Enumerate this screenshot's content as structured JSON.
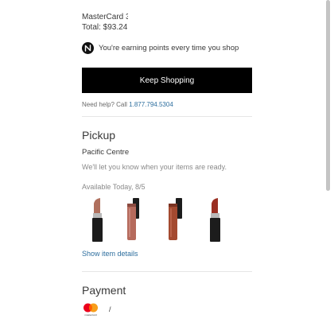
{
  "payment_summary": {
    "card_label": "MasterCard 3",
    "total_label": "Total: $93.24"
  },
  "rewards": {
    "icon": "nordstrom-n-icon",
    "message": "You're earning points every time you shop"
  },
  "keep_shopping_label": "Keep Shopping",
  "help": {
    "prefix": "Need help? Call ",
    "phone": "1.877.794.5304"
  },
  "pickup": {
    "title": "Pickup",
    "store": "Pacific Centre",
    "notify": "We'll let you know when your items are ready.",
    "availability": "Available Today, 8/5",
    "items": [
      {
        "name": "lipstick-nude",
        "icon": "lipstick-bullet-icon",
        "color": "#b0705e"
      },
      {
        "name": "liquid-lipstick-rose",
        "icon": "liquid-lipstick-icon",
        "color": "#b56a5c"
      },
      {
        "name": "liquid-lipstick-brick",
        "icon": "liquid-lipstick-icon",
        "color": "#a44a30"
      },
      {
        "name": "lipstick-red",
        "icon": "lipstick-bullet-icon",
        "color": "#9a2f22"
      }
    ],
    "show_details": "Show item details"
  },
  "payment": {
    "title": "Payment",
    "card_icon": "mastercard-icon",
    "card_brand_caption": "mastercard",
    "card_suffix": "/"
  },
  "colors": {
    "link": "#2d6e9e",
    "button_bg": "#000000",
    "text": "#393939",
    "muted": "#8a8a8a"
  }
}
